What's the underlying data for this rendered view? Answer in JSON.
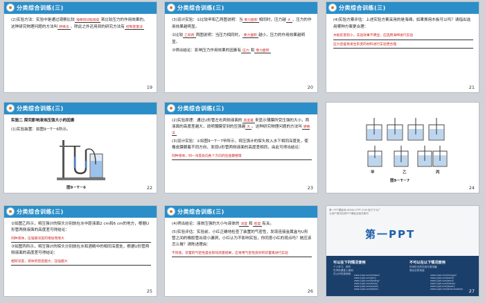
{
  "header_title": "分类综合训练(三)",
  "slides": {
    "s19": {
      "number": "19",
      "p1": "(2)实验方法：实验中是通过观察比较",
      "ans1": "海绵的凹陷程度",
      "p1b": "来比较压力的作用效果的。这种研究物理问题的方法叫",
      "ans2": "转换法",
      "p1c": "。除此之外还用到的研究方法有",
      "ans3": "控制变量法"
    },
    "s20": {
      "number": "20",
      "p1": "(3)设计实验：①比较甲和乙两图说明：当",
      "ans1": "受力面积",
      "p1b": "相同时，压力越",
      "ans2": "大",
      "p1c": "，压力的作用效果越明显。",
      "p2": "②比较",
      "ans3": "乙和丙",
      "p2b": "两图说明：当压力相同时，",
      "ans4": "受力面积",
      "p2c": "越小，压力的作用效果越明显。",
      "p3": "③得出结论：影响压力作用效果的因素有",
      "ans5": "压力",
      "p3b": "和",
      "ans6": "受力面积"
    },
    "s21": {
      "number": "21",
      "p1": "(4)实验方案评估：上述实验方案采用的是海绵，如果换用木板可以吗？请指出选用哪种方案更合理：",
      "ans1": "木板形变较小，实验效果不明显，应选用海绵进行实验",
      "ans2": "压力后容易发生形变的材料进行实验更合理"
    },
    "s22": {
      "number": "22",
      "p1": "实验二  探究影响液体压强大小的因素",
      "p2": "(1)实验装置：如图9－T－6所示。",
      "caption": "图9－T－6"
    },
    "s23": {
      "number": "23",
      "p1": "(2)实验原理：通过U形管左右两侧液面的",
      "ans1": "高度差",
      "p1b": "来显示薄膜所受压强的大小，两液面的高度差越大，说明薄膜受到的压强越",
      "ans2": "大",
      "p1c": "。这种研究物理问题的方法叫",
      "ans3": "转换法",
      "p2": "(3)设计实验：①如图9－T－7甲所示，将压强计的探头放入水下相同深度处，使橡皮膜朝着不同方向，发现U形管两侧液面的高度差相同，由此可得出结论：",
      "ans4": "同种液体，同一深度处向各个方向的压强都相等"
    },
    "s24": {
      "number": "24",
      "caption": "图9－T－7",
      "labels": [
        "甲",
        "乙",
        "丙"
      ]
    },
    "s25": {
      "number": "25",
      "p1": "②如图乙所示，将压强计的探头分别放在水中距液面2 cm和6 cm的地方，根据U形管两侧液面的高度差可得结论：",
      "ans1": "同种液体，压强随深度的增加而增大",
      "p2": "③如图丙所示，将压强计的探头分别放在水和酒精中的相同深度处，根据U形管两侧液面的高度差可得结论：",
      "ans2": "相同深度，液体的密度越大，压强越大"
    },
    "s26": {
      "number": "26",
      "p1": "(4)得出结论：液体压强的大小与液体的",
      "ans1": "深度",
      "p1b": "和",
      "ans2": "密度",
      "p1c": "有关。",
      "p2": "(5)实验评估：实验前，小红正确地检查了装置的气密性，发现连接金属盒与U形管之间的橡胶管出现小漏洞，小红认为不影响实验，你同意小红的观点吗？她应该怎么做？请陈述理由：",
      "ans3": "不同意，装置的气密性是会影响测量结果，应将用气密性良好的装置再进行实验"
    },
    "s27": {
      "number": "27",
      "logo": "第一PPT",
      "top_text": "第一PPT模板网-WWW.1PPT.COM 致力于为广大用户提供优质PPT模板及相关素材",
      "col1_title": "可以在下列情况使用",
      "col1_items": [
        "个人学习、研究",
        "在学校课堂上使用",
        "在公司内部使用"
      ],
      "col2_title": "不可以在以下情况使用",
      "col2_items": [
        "任何形式的在线付费传播",
        "商业目的用途"
      ],
      "links1": [
        "www.1ppt.com/moban/",
        "www.1ppt.com/jieri/",
        "www.1ppt.com/beijing/",
        "www.1ppt.com/ziliao/",
        "www.1ppt.com/xiazai/",
        "www.1ppt.com/kejian/"
      ],
      "links2": [
        "www.1ppt.com/hangye/",
        "www.1ppt.com/excel/",
        "www.1ppt.com/word/",
        "www.1ppt.com/tubiao/",
        "www.1ppt.com/jiaoan/",
        "www.1ppt.com/shouchaobao/"
      ]
    }
  }
}
